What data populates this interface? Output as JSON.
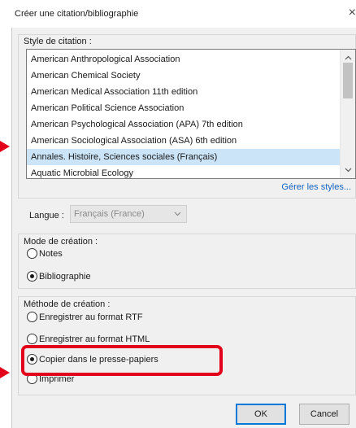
{
  "dialog": {
    "title": "Créer une citation/bibliographie",
    "close_glyph": "×"
  },
  "citation_style": {
    "label": "Style de citation :",
    "items": [
      "American Anthropological Association",
      "American Chemical Society",
      "American Medical Association 11th edition",
      "American Political Science Association",
      "American Psychological Association (APA) 7th edition",
      "American Sociological Association (ASA) 6th edition",
      "Annales. Histoire, Sciences sociales (Français)",
      "Aquatic Microbial Ecology"
    ],
    "selected_index": 6,
    "manage_link": "Gérer les styles..."
  },
  "language": {
    "label": "Langue :",
    "value": "Français (France)"
  },
  "creation_mode": {
    "label": "Mode de création :",
    "options": [
      {
        "label": "Notes",
        "checked": false
      },
      {
        "label": "Bibliographie",
        "checked": true
      }
    ]
  },
  "creation_method": {
    "label": "Méthode de création :",
    "options": [
      {
        "label": "Enregistrer au format RTF",
        "checked": false
      },
      {
        "label": "Enregistrer au format HTML",
        "checked": false
      },
      {
        "label": "Copier dans le presse-papiers",
        "checked": true
      },
      {
        "label": "Imprimer",
        "checked": false
      }
    ]
  },
  "buttons": {
    "ok": "OK",
    "cancel": "Cancel"
  },
  "icons": {
    "close": "close-icon",
    "scroll_up": "chevron-up-icon",
    "scroll_down": "chevron-down-icon",
    "select_arrow": "chevron-down-icon"
  },
  "colors": {
    "selection": "#cce4f7",
    "link": "#1565c0",
    "annotation": "#e3001b",
    "default_button_border": "#0078d7"
  }
}
